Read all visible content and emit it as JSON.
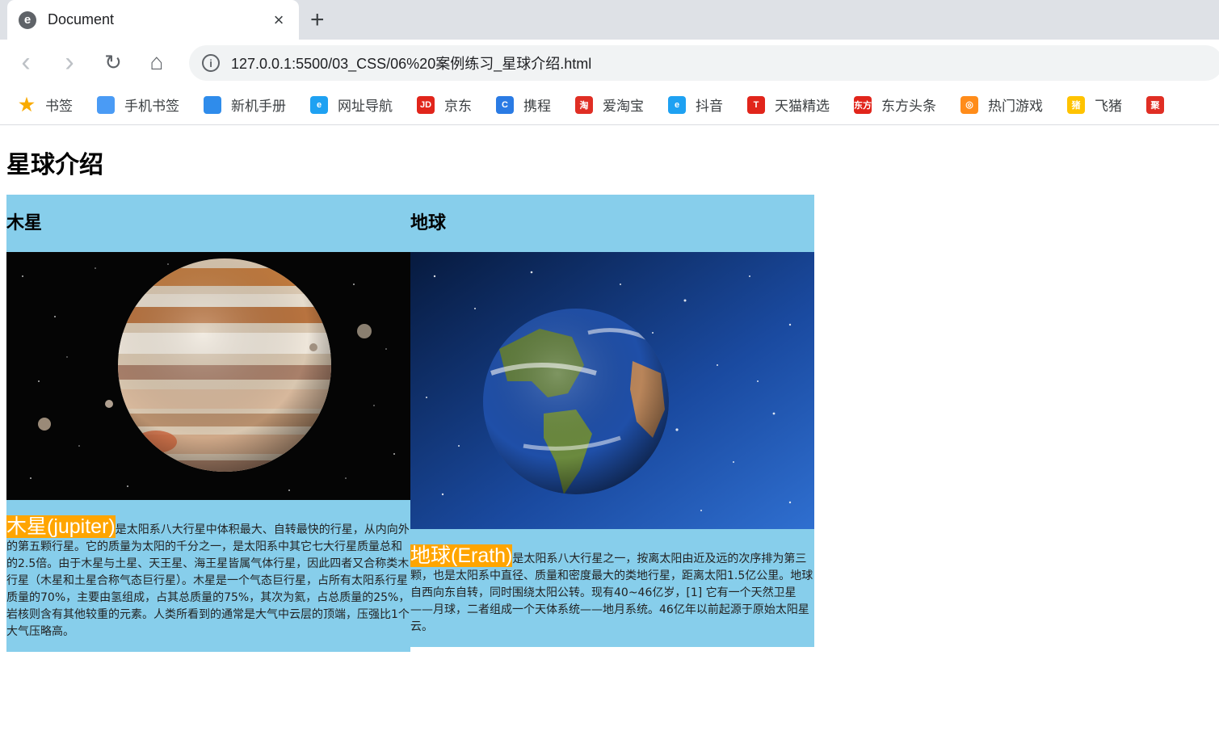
{
  "browser": {
    "tab_title": "Document",
    "favicon_letter": "e",
    "close_glyph": "×",
    "newtab_glyph": "+",
    "url": "127.0.0.1:5500/03_CSS/06%20案例练习_星球介绍.html",
    "info_glyph": "i",
    "back_glyph": "‹",
    "forward_glyph": "›",
    "reload_glyph": "↻",
    "home_glyph": "⌂"
  },
  "bookmarks": [
    {
      "label": "书签",
      "icon": "star-icon",
      "color": "#f9ab00",
      "glyph": "★"
    },
    {
      "label": "手机书签",
      "icon": "phone-icon",
      "color": "#4a9bf5",
      "glyph": ""
    },
    {
      "label": "新机手册",
      "icon": "book-icon",
      "color": "#2f8ceb",
      "glyph": ""
    },
    {
      "label": "网址导航",
      "icon": "browser-icon",
      "color": "#1ea1f2",
      "glyph": "e"
    },
    {
      "label": "京东",
      "icon": "jd-icon",
      "color": "#e1251b",
      "glyph": "JD"
    },
    {
      "label": "携程",
      "icon": "ctrip-icon",
      "color": "#2a7be4",
      "glyph": "C"
    },
    {
      "label": "爱淘宝",
      "icon": "taobao-icon",
      "color": "#e02e24",
      "glyph": "淘"
    },
    {
      "label": "抖音",
      "icon": "douyin-icon",
      "color": "#1ea1f2",
      "glyph": "e"
    },
    {
      "label": "天猫精选",
      "icon": "tmall-icon",
      "color": "#e1251b",
      "glyph": "T"
    },
    {
      "label": "东方头条",
      "icon": "toutiao-icon",
      "color": "#e1251b",
      "glyph": "东方"
    },
    {
      "label": "热门游戏",
      "icon": "game-icon",
      "color": "#ff8c1a",
      "glyph": "◎"
    },
    {
      "label": "飞猪",
      "icon": "fliggy-icon",
      "color": "#ffc300",
      "glyph": "猪"
    },
    {
      "label": "",
      "icon": "ju-icon",
      "color": "#e02e24",
      "glyph": "聚"
    }
  ],
  "page": {
    "title": "星球介绍",
    "cards": [
      {
        "heading": "木星",
        "highlight": "木星(jupiter)",
        "text": "是太阳系八大行星中体积最大、自转最快的行星，从内向外的第五颗行星。它的质量为太阳的千分之一，是太阳系中其它七大行星质量总和的2.5倍。由于木星与土星、天王星、海王星皆属气体行星，因此四者又合称类木行星（木星和土星合称气态巨行星）。木星是一个气态巨行星，占所有太阳系行星质量的70%，主要由氢组成，占其总质量的75%，其次为氦，占总质量的25%，岩核则含有其他较重的元素。人类所看到的通常是大气中云层的顶端，压强比1个大气压略高。"
      },
      {
        "heading": "地球",
        "highlight": "地球(Erath)",
        "text": "是太阳系八大行星之一，按离太阳由近及远的次序排为第三颗，也是太阳系中直径、质量和密度最大的类地行星，距离太阳1.5亿公里。地球自西向东自转，同时围绕太阳公转。现有40~46亿岁，[1] 它有一个天然卫星——月球，二者组成一个天体系统——地月系统。46亿年以前起源于原始太阳星云。"
      }
    ]
  },
  "colors": {
    "card_bg": "#87ceeb",
    "highlight_bg": "#ffa500",
    "highlight_text": "#ffffff"
  }
}
